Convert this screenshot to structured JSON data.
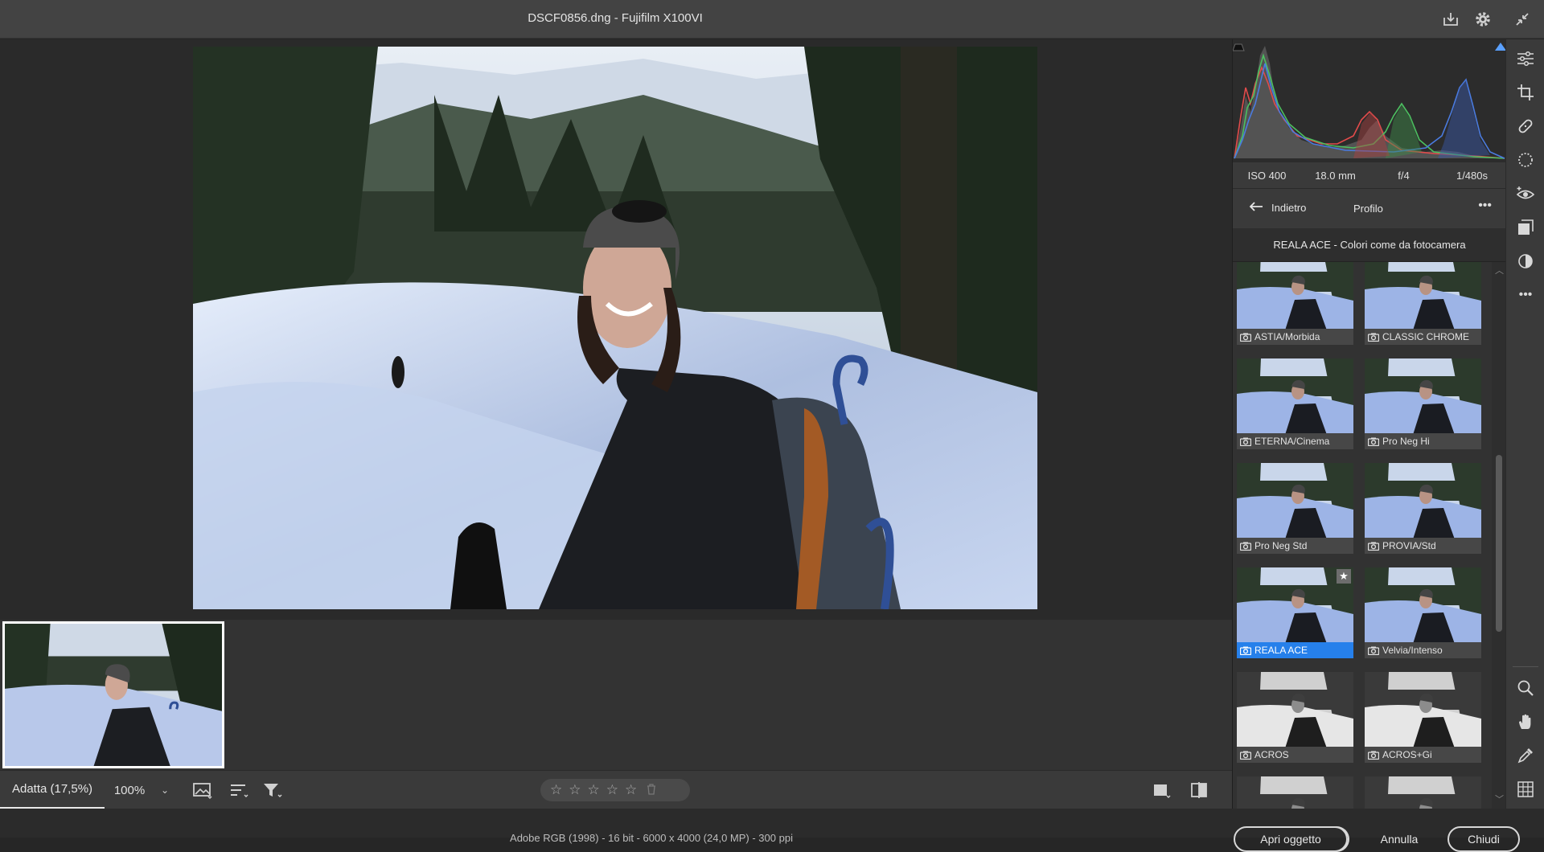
{
  "window": {
    "title": "DSCF0856.dng  -  Fujifilm X100VI"
  },
  "histogram": {
    "exif": {
      "iso": "ISO 400",
      "focal": "18.0 mm",
      "aperture": "f/4",
      "shutter": "1/480s"
    }
  },
  "profile_panel": {
    "back_label": "Indietro",
    "title": "Profilo",
    "current_profile": "REALA ACE - Colori come da fotocamera",
    "profiles": [
      {
        "label": "ASTIA/Morbida",
        "selected": false,
        "favorite": false
      },
      {
        "label": "CLASSIC CHROME",
        "selected": false,
        "favorite": false
      },
      {
        "label": "ETERNA/Cinema",
        "selected": false,
        "favorite": false
      },
      {
        "label": "Pro Neg Hi",
        "selected": false,
        "favorite": false
      },
      {
        "label": "Pro Neg Std",
        "selected": false,
        "favorite": false
      },
      {
        "label": "PROVIA/Std",
        "selected": false,
        "favorite": false
      },
      {
        "label": "REALA ACE",
        "selected": true,
        "favorite": true
      },
      {
        "label": "Velvia/Intenso",
        "selected": false,
        "favorite": false
      },
      {
        "label": "ACROS",
        "selected": false,
        "favorite": false
      },
      {
        "label": "ACROS+Gi",
        "selected": false,
        "favorite": false
      },
      {
        "label": "",
        "selected": false,
        "favorite": false
      },
      {
        "label": "",
        "selected": false,
        "favorite": false
      }
    ]
  },
  "bottombar": {
    "zoom_fit": "Adatta (17,5%)",
    "zoom_100": "100%"
  },
  "footer": {
    "info": "Adobe RGB (1998) - 16 bit - 6000 x 4000 (24,0 MP) - 300 ppi",
    "open_button": "Apri oggetto",
    "cancel_button": "Annulla",
    "done_button": "Chiudi"
  },
  "colors": {
    "accent": "#2680eb",
    "panel_bg": "#323232",
    "titlebar_bg": "#434343"
  }
}
